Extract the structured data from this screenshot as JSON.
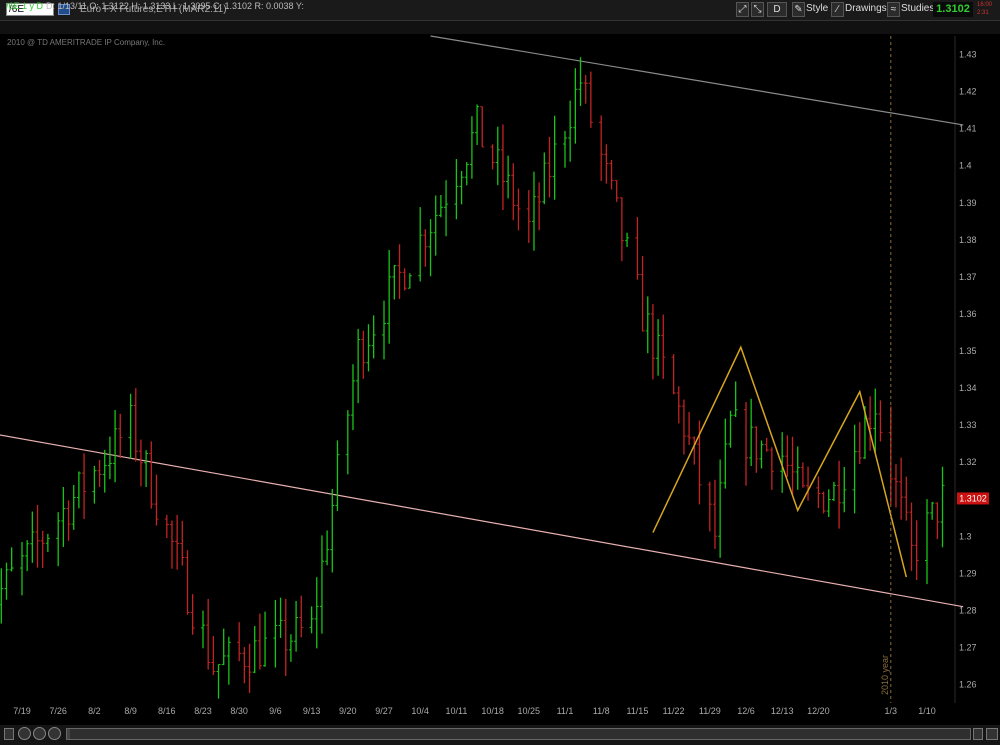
{
  "toolbar": {
    "symbol": "/6E",
    "title": "Euro FX Futures,ETH (MAR2:11)",
    "d_label": "D",
    "style_label": "Style",
    "drawings_label": "Drawings",
    "studies_label": "Studies",
    "last_price": "1.3102",
    "time_line1": "16:00",
    "time_line2": "2:31"
  },
  "info": {
    "symbol_period": "/6E 1 y D",
    "ohlc": "D: 1/13/11   O: 1.3122   H: 1.3133   L: 1.3095   C: 1.3102   R: 0.0038   Y:"
  },
  "copyright": "2010 @ TD AMERITRADE IP Company, Inc.",
  "colors": {
    "up": "#19c419",
    "down": "#c22424",
    "upper_trend": "#8a8a8a",
    "lower_trend": "#e8b0b0",
    "pattern": "#d6a520",
    "price_tag": "#cc1111"
  },
  "chart_data": {
    "type": "ohlc",
    "ylim": [
      1.255,
      1.435
    ],
    "ytick_step": 0.01,
    "yticks": [
      "1.26",
      "1.27",
      "1.28",
      "1.29",
      "1.3",
      "1.31",
      "1.32",
      "1.33",
      "1.34",
      "1.35",
      "1.36",
      "1.37",
      "1.38",
      "1.39",
      "1.4",
      "1.41",
      "1.42",
      "1.43"
    ],
    "xlabels": [
      "7/19",
      "7/26",
      "8/2",
      "8/9",
      "8/16",
      "8/23",
      "8/30",
      "9/6",
      "9/13",
      "9/20",
      "9/27",
      "10/4",
      "10/11",
      "10/18",
      "10/25",
      "11/1",
      "11/8",
      "11/15",
      "11/22",
      "11/29",
      "12/6",
      "12/13",
      "12/20",
      "1/3",
      "1/10"
    ],
    "x_label_dates": [
      "2010-07-19",
      "2010-07-26",
      "2010-08-02",
      "2010-08-09",
      "2010-08-16",
      "2010-08-23",
      "2010-08-30",
      "2010-09-06",
      "2010-09-13",
      "2010-09-20",
      "2010-09-27",
      "2010-10-04",
      "2010-10-11",
      "2010-10-18",
      "2010-10-25",
      "2010-11-01",
      "2010-11-08",
      "2010-11-15",
      "2010-11-22",
      "2010-11-29",
      "2010-12-06",
      "2010-12-13",
      "2010-12-20",
      "2011-01-03",
      "2011-01-10"
    ],
    "current_price": "1.3102",
    "current_value": 1.3102,
    "year_divider": {
      "date": "2011-01-03",
      "label": "2010 year"
    },
    "key_points": [
      [
        "2010-07-12",
        1.28
      ],
      [
        "2010-08-09",
        1.33
      ],
      [
        "2010-08-25",
        1.265
      ],
      [
        "2010-09-13",
        1.275
      ],
      [
        "2010-09-22",
        1.35
      ],
      [
        "2010-10-08",
        1.39
      ],
      [
        "2010-10-15",
        1.41
      ],
      [
        "2010-10-25",
        1.383
      ],
      [
        "2010-11-04",
        1.423
      ],
      [
        "2010-11-16",
        1.36
      ],
      [
        "2010-11-24",
        1.33
      ],
      [
        "2010-11-30",
        1.3
      ],
      [
        "2010-12-03",
        1.33
      ],
      [
        "2010-12-07",
        1.325
      ],
      [
        "2010-12-13",
        1.322
      ],
      [
        "2010-12-17",
        1.31
      ],
      [
        "2010-12-23",
        1.312
      ],
      [
        "2010-12-31",
        1.336
      ],
      [
        "2011-01-07",
        1.295
      ],
      [
        "2011-01-13",
        1.31
      ]
    ],
    "trendlines": [
      {
        "name": "upper",
        "from": [
          "2010-10-06",
          1.435
        ],
        "to": [
          "2011-01-17",
          1.411
        ]
      },
      {
        "name": "lower",
        "from": [
          "2010-07-08",
          1.329
        ],
        "to": [
          "2011-01-17",
          1.281
        ]
      }
    ],
    "pattern_points": [
      [
        "2010-11-18",
        1.301
      ],
      [
        "2010-12-05",
        1.351
      ],
      [
        "2010-12-16",
        1.307
      ],
      [
        "2010-12-28",
        1.339
      ],
      [
        "2011-01-06",
        1.289
      ]
    ]
  }
}
